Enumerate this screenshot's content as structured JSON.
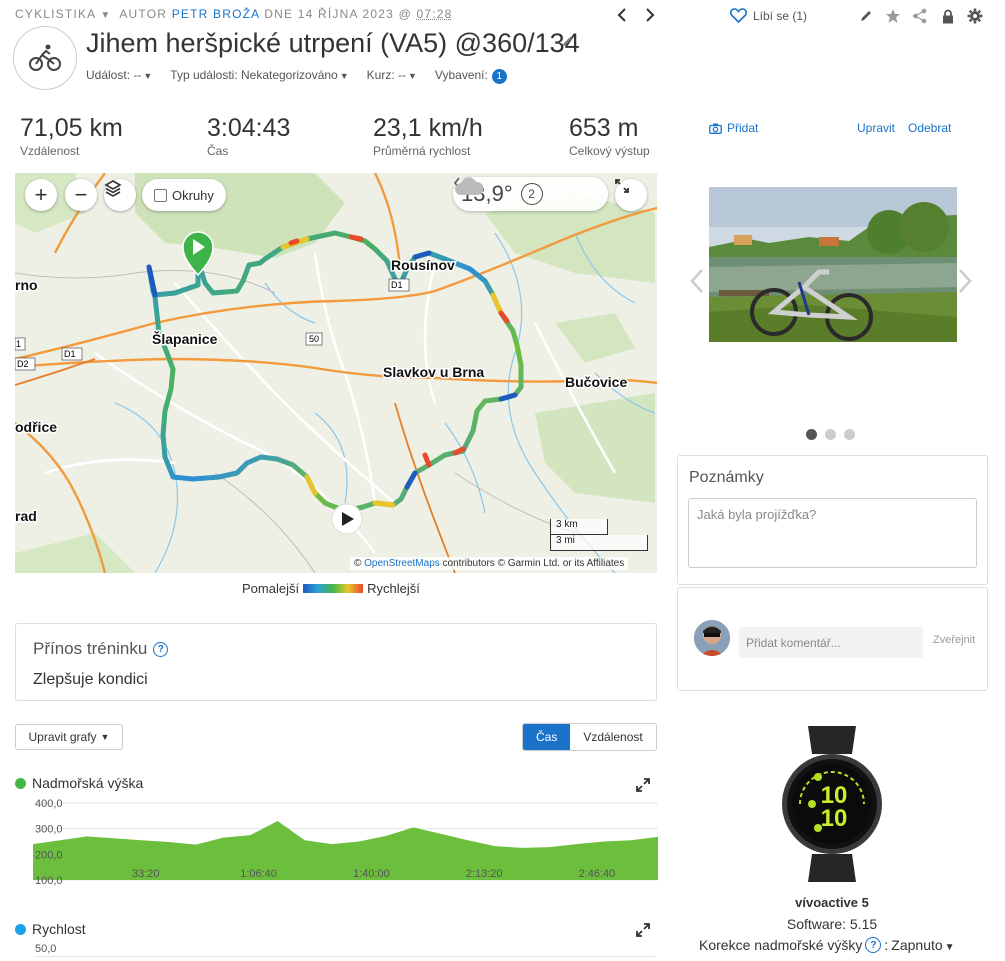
{
  "header": {
    "category": "CYKLISTIKA",
    "author_prefix": "AUTOR",
    "author": "PETR BROŽA",
    "date_prefix": "DNE 14 ŘÍJNA 2023 @",
    "time": "07:28",
    "like_label": "Líbí se (1)",
    "title": "Jihem heršpické utrpení (VA5) @360/134",
    "meta": {
      "event": "Událost: --",
      "event_type": "Typ události: Nekategorizováno",
      "course": "Kurz: --",
      "gear_label": "Vybavení:",
      "gear_count": "1"
    }
  },
  "stats": [
    {
      "value": "71,05 km",
      "label": "Vzdálenost"
    },
    {
      "value": "3:04:43",
      "label": "Čas"
    },
    {
      "value": "23,1 km/h",
      "label": "Průměrná rychlost"
    },
    {
      "value": "653 m",
      "label": "Celkový výstup"
    }
  ],
  "map": {
    "okruhy_label": "Okruhy",
    "temperature": "13,9°",
    "wind_badge": "2",
    "places": {
      "brno": "rno",
      "slapanice": "Šlapanice",
      "slavkov": "Slavkov u Brna",
      "bucovice": "Bučovice",
      "rousinov": "Rousínov",
      "modrice": "odřice",
      "hrad": "rad"
    },
    "road_labels": {
      "d1_a": "D1",
      "d1_b": "D1",
      "d2": "D2",
      "r50": "50",
      "e1": "1",
      "d1_c": "D1"
    },
    "scale_km": "3 km",
    "scale_mi": "3 mi",
    "attribution_prefix": "©",
    "attribution_osm": "OpenStreetMaps",
    "attribution_rest": "contributors © Garmin Ltd. or its Affiliates"
  },
  "legend": {
    "slower": "Pomalejší",
    "faster": "Rychlejší"
  },
  "training": {
    "title": "Přínos tréninku",
    "value": "Zlepšuje kondici"
  },
  "charts_controls": {
    "edit_label": "Upravit grafy",
    "time_label": "Čas",
    "distance_label": "Vzdálenost"
  },
  "elevation_chart": {
    "title": "Nadmořská výška",
    "y_ticks": [
      "400,0",
      "300,0",
      "200,0",
      "100,0"
    ],
    "x_ticks": [
      "33:20",
      "1:06:40",
      "1:40:00",
      "2:13:20",
      "2:46:40"
    ],
    "color": "#6cbf3c"
  },
  "speed_chart": {
    "title": "Rychlost",
    "y_tick": "50,0",
    "color": "#1aa3e8"
  },
  "chart_data": {
    "type": "area",
    "title": "Nadmořská výška",
    "xlabel": "",
    "ylabel": "",
    "x": [
      "0:00",
      "0:08",
      "0:16",
      "0:25",
      "0:33",
      "0:41",
      "0:50",
      "0:58",
      "1:06",
      "1:10",
      "1:15",
      "1:23",
      "1:31",
      "1:40",
      "1:48",
      "1:56",
      "2:05",
      "2:13",
      "2:21",
      "2:30",
      "2:38",
      "2:46",
      "2:55",
      "3:04"
    ],
    "values": [
      240,
      255,
      270,
      262,
      255,
      248,
      238,
      265,
      275,
      330,
      255,
      240,
      250,
      272,
      305,
      280,
      255,
      232,
      225,
      228,
      240,
      250,
      255,
      268
    ],
    "ylim": [
      100,
      400
    ],
    "x_ticks": [
      "33:20",
      "1:06:40",
      "1:40:00",
      "2:13:20",
      "2:46:40"
    ],
    "y_ticks": [
      400,
      300,
      200,
      100
    ],
    "grid": true
  },
  "right": {
    "add_photo": "Přidat",
    "edit": "Upravit",
    "remove": "Odebrat",
    "notes_title": "Poznámky",
    "notes_placeholder": "Jaká byla projížďka?",
    "comment_placeholder": "Přidat komentář...",
    "post": "Zveřejnit",
    "device_name": "vívoactive 5",
    "software": "Software: 5.15",
    "elev_corr_label": "Korekce nadmořské výšky",
    "elev_corr_value": "Zapnuto",
    "watch_hour": "10",
    "watch_min": "10"
  }
}
